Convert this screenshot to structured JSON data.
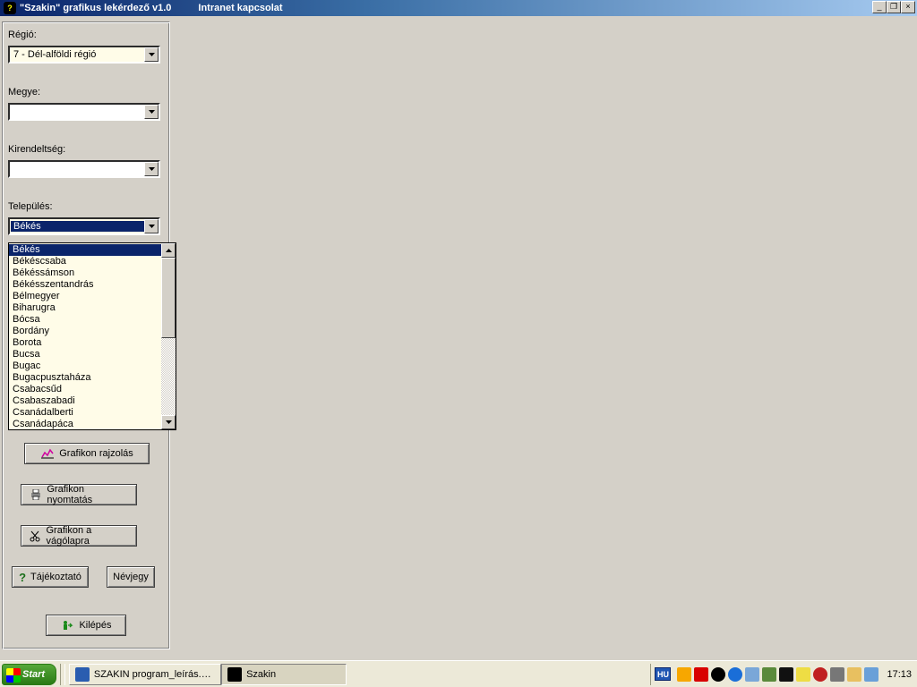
{
  "window": {
    "title": "\"Szakin\" grafikus lekérdező  v1.0",
    "subtitle": "Intranet kapcsolat",
    "min_btn": "_",
    "max_btn": "❐",
    "close_btn": "×"
  },
  "sidebar": {
    "regio_label": "Régió:",
    "regio_value": "7 - Dél-alföldi régió",
    "megye_label": "Megye:",
    "megye_value": "",
    "kirendeltseg_label": "Kirendeltség:",
    "kirendeltseg_value": "",
    "telepules_label": "Település:",
    "telepules_value": "Békés",
    "telepules_options": [
      "Békés",
      "Békéscsaba",
      "Békéssámson",
      "Békésszentandrás",
      "Bélmegyer",
      "Biharugra",
      "Bócsa",
      "Bordány",
      "Borota",
      "Bucsa",
      "Bugac",
      "Bugacpusztaháza",
      "Csabacsűd",
      "Csabaszabadi",
      "Csanádalberti",
      "Csanádapáca"
    ],
    "btn_rajzolas": "Grafikon rajzolás",
    "btn_nyomtatas": "Grafikon nyomtatás",
    "btn_vagolap": "Grafikon a vágólapra",
    "btn_tajekoztato": "Tájékoztató",
    "btn_nevjegy": "Névjegy",
    "btn_kilepes": "Kilépés"
  },
  "taskbar": {
    "start": "Start",
    "task1": "SZAKIN program_leírás.d…",
    "task2": "Szakin",
    "lang": "HU",
    "clock": "17:13"
  },
  "colors": {
    "title_grad_start": "#0A246A",
    "title_grad_end": "#A6CAF0",
    "panel_bg": "#D4D0C8",
    "input_bg": "#FFFCE8",
    "selection_bg": "#0A246A"
  }
}
